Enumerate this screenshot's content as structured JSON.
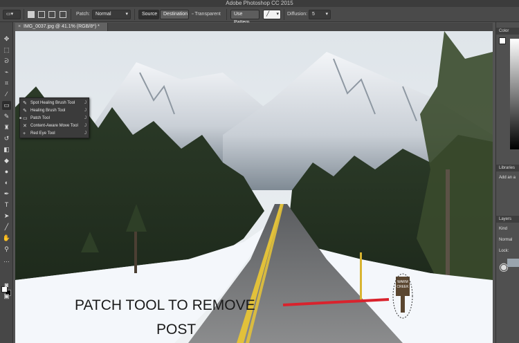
{
  "app": {
    "title": "Adobe Photoshop CC 2015"
  },
  "options_bar": {
    "patch_label": "Patch:",
    "patch_value": "Normal",
    "source_label": "Source",
    "destination_label": "Destination",
    "transparent_label": "Transparent",
    "use_pattern_label": "Use Pattern",
    "diffusion_label": "Diffusion:",
    "diffusion_value": "5"
  },
  "document_tab": {
    "label": "IMG_0037.jpg @ 41.1% (RGB/8*) *"
  },
  "flyout_menu": {
    "items": [
      {
        "label": "Spot Healing Brush Tool",
        "shortcut": "J",
        "icon": "spot-healing-brush-icon"
      },
      {
        "label": "Healing Brush Tool",
        "shortcut": "J",
        "icon": "healing-brush-icon"
      },
      {
        "label": "Patch Tool",
        "shortcut": "J",
        "icon": "patch-icon",
        "selected": true
      },
      {
        "label": "Content-Aware Move Tool",
        "shortcut": "J",
        "icon": "content-aware-move-icon"
      },
      {
        "label": "Red Eye Tool",
        "shortcut": "J",
        "icon": "red-eye-icon"
      }
    ]
  },
  "annotation": {
    "line1": "PATCH TOOL TO REMOVE",
    "line2": "POST",
    "arrow_color": "#d9232d"
  },
  "sign": {
    "line1": "WARM",
    "line2": "CREEK"
  },
  "right_panel": {
    "color_tab": "Color",
    "libraries_tab": "Libraries",
    "add_text": "Add an a",
    "layers_tab": "Layers",
    "kind_label": "Kind",
    "mode_label": "Normal",
    "lock_label": "Lock:"
  },
  "colors": {
    "ui_dark": "#535353",
    "panel": "#474747",
    "accent_red": "#d9232d"
  }
}
